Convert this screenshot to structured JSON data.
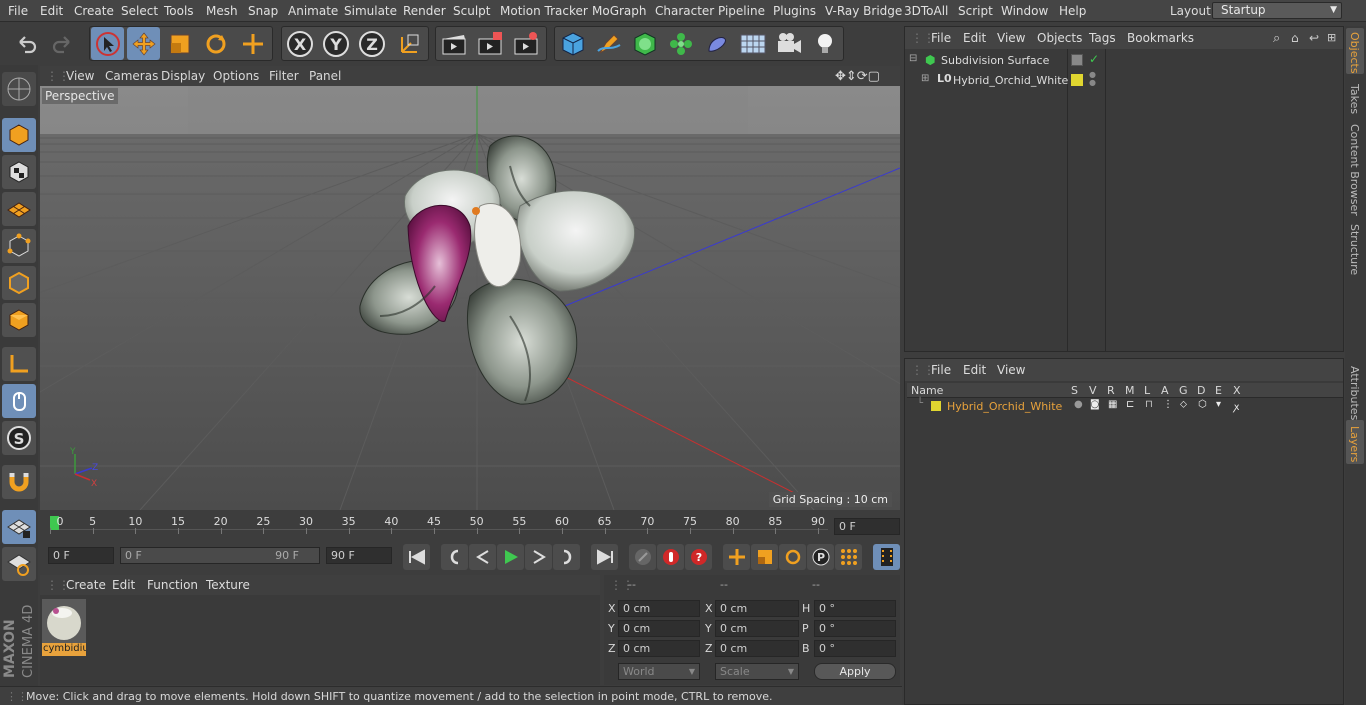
{
  "menubar": {
    "items": [
      "File",
      "Edit",
      "Create",
      "Select",
      "Tools",
      "Mesh",
      "Snap",
      "Animate",
      "Simulate",
      "Render",
      "Sculpt",
      "Motion Tracker",
      "MoGraph",
      "Character",
      "Pipeline",
      "Plugins",
      "V-Ray Bridge",
      "3DToAll",
      "Script",
      "Window",
      "Help"
    ],
    "layout_label": "Layout:",
    "layout_value": "Startup"
  },
  "viewport": {
    "menu": [
      "View",
      "Cameras",
      "Display",
      "Options",
      "Filter",
      "Panel"
    ],
    "label": "Perspective",
    "grid_spacing": "Grid Spacing : 10 cm"
  },
  "timeline": {
    "ticks": [
      "0",
      "5",
      "10",
      "15",
      "20",
      "25",
      "30",
      "35",
      "40",
      "45",
      "50",
      "55",
      "60",
      "65",
      "70",
      "75",
      "80",
      "85",
      "90"
    ],
    "current_frame": "0 F"
  },
  "playbar": {
    "start_field": "0 F",
    "range_start": "0 F",
    "range_end": "90 F",
    "end_field": "90 F"
  },
  "material": {
    "menu": [
      "Create",
      "Edit",
      "Function",
      "Texture"
    ],
    "name": "cymbidiu"
  },
  "coords": {
    "headers": [
      "--",
      "--",
      "--"
    ],
    "rows": [
      {
        "a": "X",
        "av": "0 cm",
        "b": "X",
        "bv": "0 cm",
        "c": "H",
        "cv": "0 °"
      },
      {
        "a": "Y",
        "av": "0 cm",
        "b": "Y",
        "bv": "0 cm",
        "c": "P",
        "cv": "0 °"
      },
      {
        "a": "Z",
        "av": "0 cm",
        "b": "Z",
        "bv": "0 cm",
        "c": "B",
        "cv": "0 °"
      }
    ],
    "world": "World",
    "scale": "Scale",
    "apply": "Apply"
  },
  "status": "Move: Click and drag to move elements. Hold down SHIFT to quantize movement / add to the selection in point mode, CTRL to remove.",
  "objects": {
    "menu": [
      "File",
      "Edit",
      "View",
      "Objects",
      "Tags",
      "Bookmarks"
    ],
    "items": [
      "Subdivision Surface",
      "Hybrid_Orchid_White"
    ]
  },
  "layers": {
    "menu": [
      "File",
      "Edit",
      "View"
    ],
    "columns": [
      "Name",
      "S",
      "V",
      "R",
      "M",
      "L",
      "A",
      "G",
      "D",
      "E",
      "X"
    ],
    "row": "Hybrid_Orchid_White"
  },
  "sidetabs": [
    "Objects",
    "Takes",
    "Content Browser",
    "Structure",
    "Attributes",
    "Layers"
  ],
  "colors": {
    "accent": "#e8a23c",
    "selection": "#6f8fb8",
    "yellow": "#e0d630"
  }
}
